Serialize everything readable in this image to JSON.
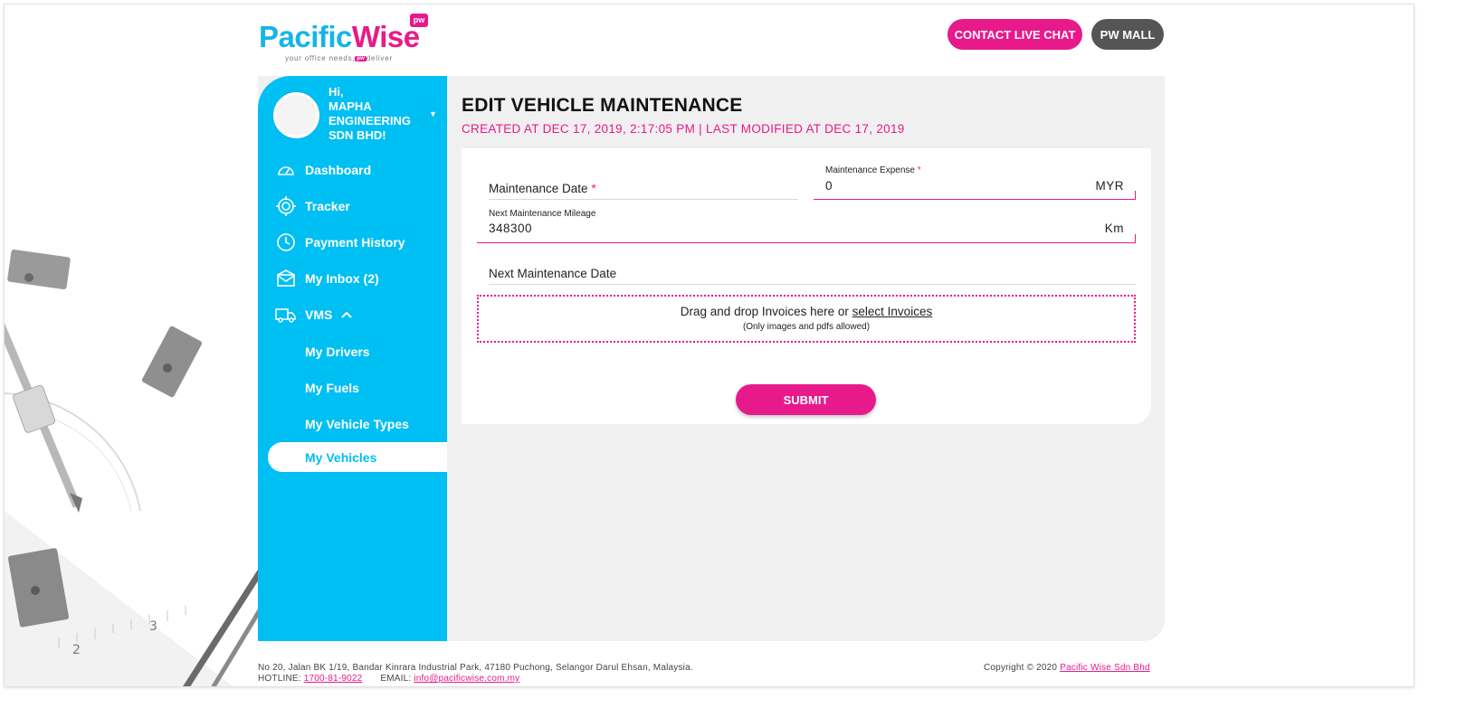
{
  "brand": {
    "logo_part1": "Paci",
    "logo_part2": "fic",
    "logo_part3": "Wise",
    "badge": "pw",
    "tagline_pre": "your office needs,",
    "tagline_badge": "pw",
    "tagline_post": "deliver"
  },
  "header": {
    "contact_chat": "CONTACT LIVE CHAT",
    "pw_mall": "PW MALL"
  },
  "user": {
    "greeting": "Hi,",
    "company": "MAPHA ENGINEERING SDN BHD!"
  },
  "sidebar": {
    "items": [
      {
        "label": "Dashboard",
        "icon": "dashboard-gauge-icon"
      },
      {
        "label": "Tracker",
        "icon": "tracker-target-icon"
      },
      {
        "label": "Payment History",
        "icon": "clock-history-icon"
      },
      {
        "label": "My Inbox (2)",
        "icon": "envelope-icon"
      },
      {
        "label": "VMS",
        "icon": "truck-icon",
        "expanded": true
      },
      {
        "label": "My Drivers"
      },
      {
        "label": "My Fuels"
      },
      {
        "label": "My Vehicle Types"
      },
      {
        "label": "My Vehicles",
        "active": true
      }
    ]
  },
  "page": {
    "title": "EDIT VEHICLE MAINTENANCE",
    "subtitle": "CREATED AT DEC 17, 2019, 2:17:05 PM | LAST MODIFIED AT DEC 17, 2019"
  },
  "form": {
    "maintenance_date_label": "Maintenance Date",
    "required_mark": "*",
    "expense_label": "Maintenance Expense",
    "expense_value": "0",
    "expense_unit": "MYR",
    "mileage_label": "Next Maintenance Mileage",
    "mileage_value": "348300",
    "mileage_unit": "Km",
    "next_date_label": "Next Maintenance Date",
    "dropzone_text": "Drag and drop Invoices here or",
    "dropzone_link": "select Invoices",
    "dropzone_note": "(Only images and pdfs allowed)",
    "submit": "SUBMIT"
  },
  "footer": {
    "address": "No 20, Jalan BK 1/19, Bandar Kinrara Industrial Park, 47180 Puchong, Selangor Darul Ehsan, Malaysia.",
    "hotline_label": "HOTLINE:",
    "hotline": "1700-81-9022",
    "email_label": "EMAIL:",
    "email": "info@pacificwise.com.my",
    "copyright": "Copyright © 2020",
    "company_link": "Pacific Wise Sdn Bhd"
  },
  "colors": {
    "brand_blue": "#00bff3",
    "brand_pink": "#e8198b",
    "panel_gray": "#f0f0f0",
    "mall_button": "#555555"
  }
}
